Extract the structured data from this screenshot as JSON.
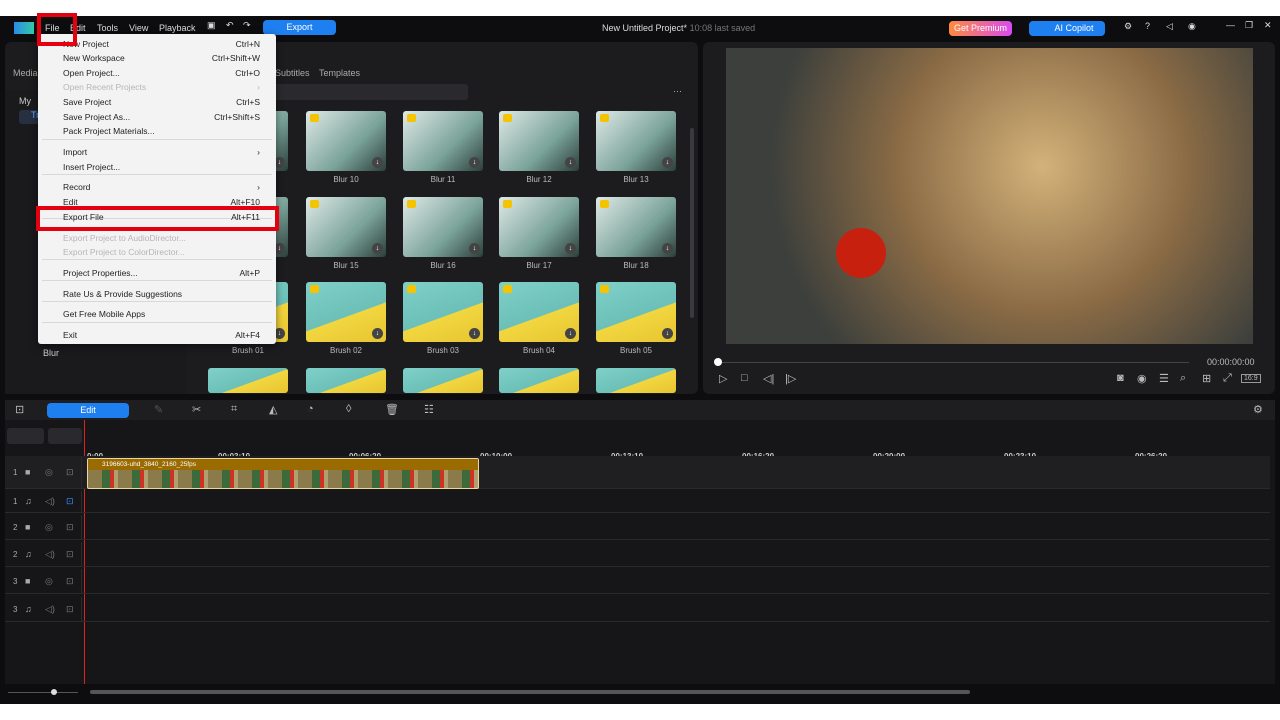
{
  "menubar": {
    "items": [
      "File",
      "Edit",
      "Tools",
      "View",
      "Playback"
    ],
    "export_label": "Export",
    "project_title": "New Untitled Project*",
    "last_saved": "10:08 last saved",
    "premium_label": "Get Premium",
    "copilot_label": "AI Copilot"
  },
  "library_tabs": [
    "Media",
    "Subtitles",
    "Templates"
  ],
  "sidebar": {
    "items": [
      "My",
      "Tr",
      "Blur"
    ]
  },
  "file_menu": {
    "items": [
      {
        "label": "New Project",
        "shortcut": "Ctrl+N"
      },
      {
        "label": "New Workspace",
        "shortcut": "Ctrl+Shift+W"
      },
      {
        "label": "Open Project...",
        "shortcut": "Ctrl+O"
      },
      {
        "label": "Open Recent Projects",
        "shortcut": "›",
        "disabled": true
      },
      {
        "label": "Save Project",
        "shortcut": "Ctrl+S"
      },
      {
        "label": "Save Project As...",
        "shortcut": "Ctrl+Shift+S"
      },
      {
        "label": "Pack Project Materials...",
        "shortcut": ""
      },
      {
        "label": "Import",
        "shortcut": "›"
      },
      {
        "label": "Insert Project...",
        "shortcut": ""
      },
      {
        "label": "Record",
        "shortcut": "›"
      },
      {
        "label": "Edit",
        "shortcut": "Alt+F10"
      },
      {
        "label": "Export File",
        "shortcut": "Alt+F11"
      },
      {
        "label": "Export Project to AudioDirector...",
        "shortcut": "",
        "disabled": true
      },
      {
        "label": "Export Project to ColorDirector...",
        "shortcut": "",
        "disabled": true
      },
      {
        "label": "Project Properties...",
        "shortcut": "Alt+P"
      },
      {
        "label": "Rate Us & Provide Suggestions",
        "shortcut": ""
      },
      {
        "label": "Get Free Mobile Apps",
        "shortcut": ""
      },
      {
        "label": "Exit",
        "shortcut": "Alt+F4"
      }
    ]
  },
  "effects": {
    "rows": [
      [
        "",
        "Blur 10",
        "Blur 11",
        "Blur 12",
        "Blur 13"
      ],
      [
        "",
        "Blur 15",
        "Blur 16",
        "Blur 17",
        "Blur 18"
      ],
      [
        "Brush 01",
        "Brush 02",
        "Brush 03",
        "Brush 04",
        "Brush 05"
      ]
    ]
  },
  "preview": {
    "timecode": "00:00:00:00",
    "aspect": "16:9",
    "progress": 0
  },
  "timeline": {
    "edit_label": "Edit",
    "ruler": [
      "0:00",
      "00:03:10",
      "00:06:20",
      "00:10:00",
      "00:13:10",
      "00:16:20",
      "00:20:00",
      "00:23:10",
      "00:26:20"
    ],
    "tracks": [
      {
        "num": "1",
        "type": "video"
      },
      {
        "num": "1",
        "type": "audio"
      },
      {
        "num": "2",
        "type": "video"
      },
      {
        "num": "2",
        "type": "audio"
      },
      {
        "num": "3",
        "type": "video"
      },
      {
        "num": "3",
        "type": "audio"
      }
    ],
    "clip_name": "3196603-uhd_3840_2160_25fps"
  },
  "colors": {
    "accent": "#1e7ff0",
    "highlight": "#e5000f",
    "clip": "#9a6b00"
  }
}
